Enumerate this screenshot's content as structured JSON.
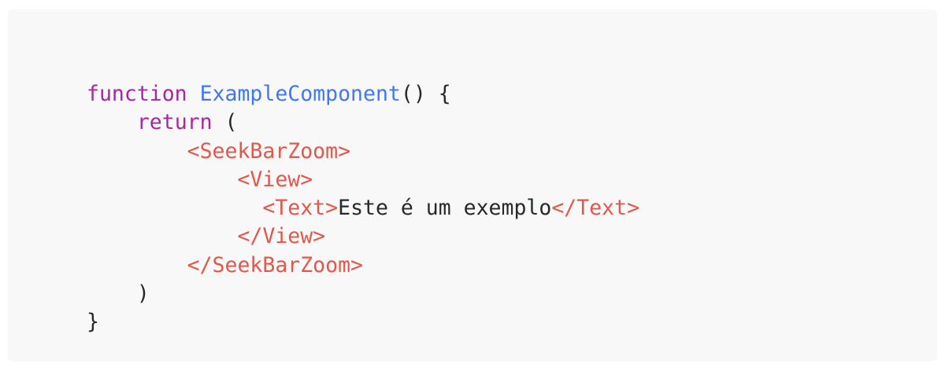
{
  "code": {
    "lines": [
      [
        {
          "text": "function",
          "kind": "keyword"
        },
        {
          "text": " ",
          "kind": "plain"
        },
        {
          "text": "ExampleComponent",
          "kind": "function"
        },
        {
          "text": "() {",
          "kind": "plain"
        }
      ],
      [
        {
          "text": "    ",
          "kind": "plain"
        },
        {
          "text": "return",
          "kind": "keyword"
        },
        {
          "text": " (",
          "kind": "plain"
        }
      ],
      [
        {
          "text": "        ",
          "kind": "plain"
        },
        {
          "text": "<SeekBarZoom>",
          "kind": "tag"
        }
      ],
      [
        {
          "text": "            ",
          "kind": "plain"
        },
        {
          "text": "<View>",
          "kind": "tag"
        }
      ],
      [
        {
          "text": "              ",
          "kind": "plain"
        },
        {
          "text": "<Text>",
          "kind": "tag"
        },
        {
          "text": "Este é um exemplo",
          "kind": "plain"
        },
        {
          "text": "</Text>",
          "kind": "tag"
        }
      ],
      [
        {
          "text": "            ",
          "kind": "plain"
        },
        {
          "text": "</View>",
          "kind": "tag"
        }
      ],
      [
        {
          "text": "        ",
          "kind": "plain"
        },
        {
          "text": "</SeekBarZoom>",
          "kind": "tag"
        }
      ],
      [
        {
          "text": "    )",
          "kind": "plain"
        }
      ],
      [
        {
          "text": "}",
          "kind": "plain"
        }
      ]
    ]
  },
  "colors": {
    "background": "#f8f8f8",
    "keyword": "#a626a4",
    "function": "#4078f2",
    "tag": "#e45649",
    "plain": "#24292e"
  }
}
